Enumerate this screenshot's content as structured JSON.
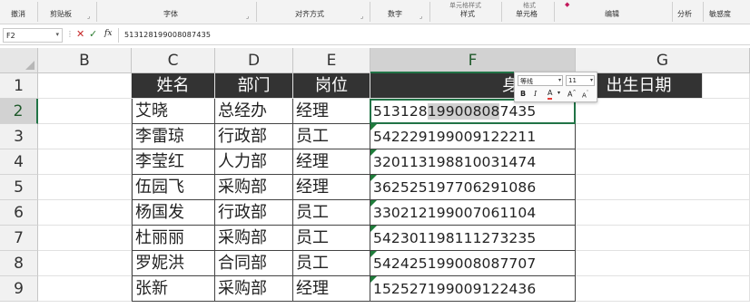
{
  "ribbon": {
    "groups": [
      "撤消",
      "剪贴板",
      "字体",
      "对齐方式",
      "数字",
      "样式",
      "单元格",
      "编辑",
      "分析",
      "敏感度"
    ],
    "top_fragments": [
      "单元格样式",
      "格式"
    ]
  },
  "formula_bar": {
    "name_box": "F2",
    "dots": "⋮",
    "fx": "fx",
    "value": "513128199008087435"
  },
  "columns": [
    "B",
    "C",
    "D",
    "E",
    "F",
    "G"
  ],
  "selected_column": "F",
  "rows": [
    "1",
    "2",
    "3",
    "4",
    "5",
    "6",
    "7",
    "8",
    "9"
  ],
  "selected_row": "2",
  "table": {
    "headers": [
      "姓名",
      "部门",
      "岗位",
      "身份证号",
      "出生日期"
    ],
    "records": [
      {
        "name": "艾晓",
        "dept": "总经办",
        "post": "经理",
        "id": "513128199008087435"
      },
      {
        "name": "李雷琼",
        "dept": "行政部",
        "post": "员工",
        "id": "542229199009122211"
      },
      {
        "name": "李莹红",
        "dept": "人力部",
        "post": "经理",
        "id": "320113198810031474"
      },
      {
        "name": "伍园飞",
        "dept": "采购部",
        "post": "经理",
        "id": "362525197706291086"
      },
      {
        "name": "杨国发",
        "dept": "行政部",
        "post": "员工",
        "id": "330212199007061104"
      },
      {
        "name": "杜丽丽",
        "dept": "采购部",
        "post": "员工",
        "id": "542301198111273235"
      },
      {
        "name": "罗妮洪",
        "dept": "合同部",
        "post": "员工",
        "id": "542425199008087707"
      },
      {
        "name": "张新",
        "dept": "采购部",
        "post": "经理",
        "id": "152527199009122436"
      }
    ]
  },
  "selection": {
    "cell": "F2",
    "highlight_start": "513128",
    "highlight_mid": "19900808",
    "highlight_end": "7435"
  },
  "mini_toolbar": {
    "font": "等线",
    "size": "11",
    "bold": "B",
    "italic": "I",
    "font_color": "A",
    "grow": "A",
    "shrink": "A"
  },
  "colors": {
    "header_bg": "#333333",
    "accent": "#217346",
    "error_indicator": "#1e7c3a",
    "selection_highlight": "#d0d0d0"
  }
}
